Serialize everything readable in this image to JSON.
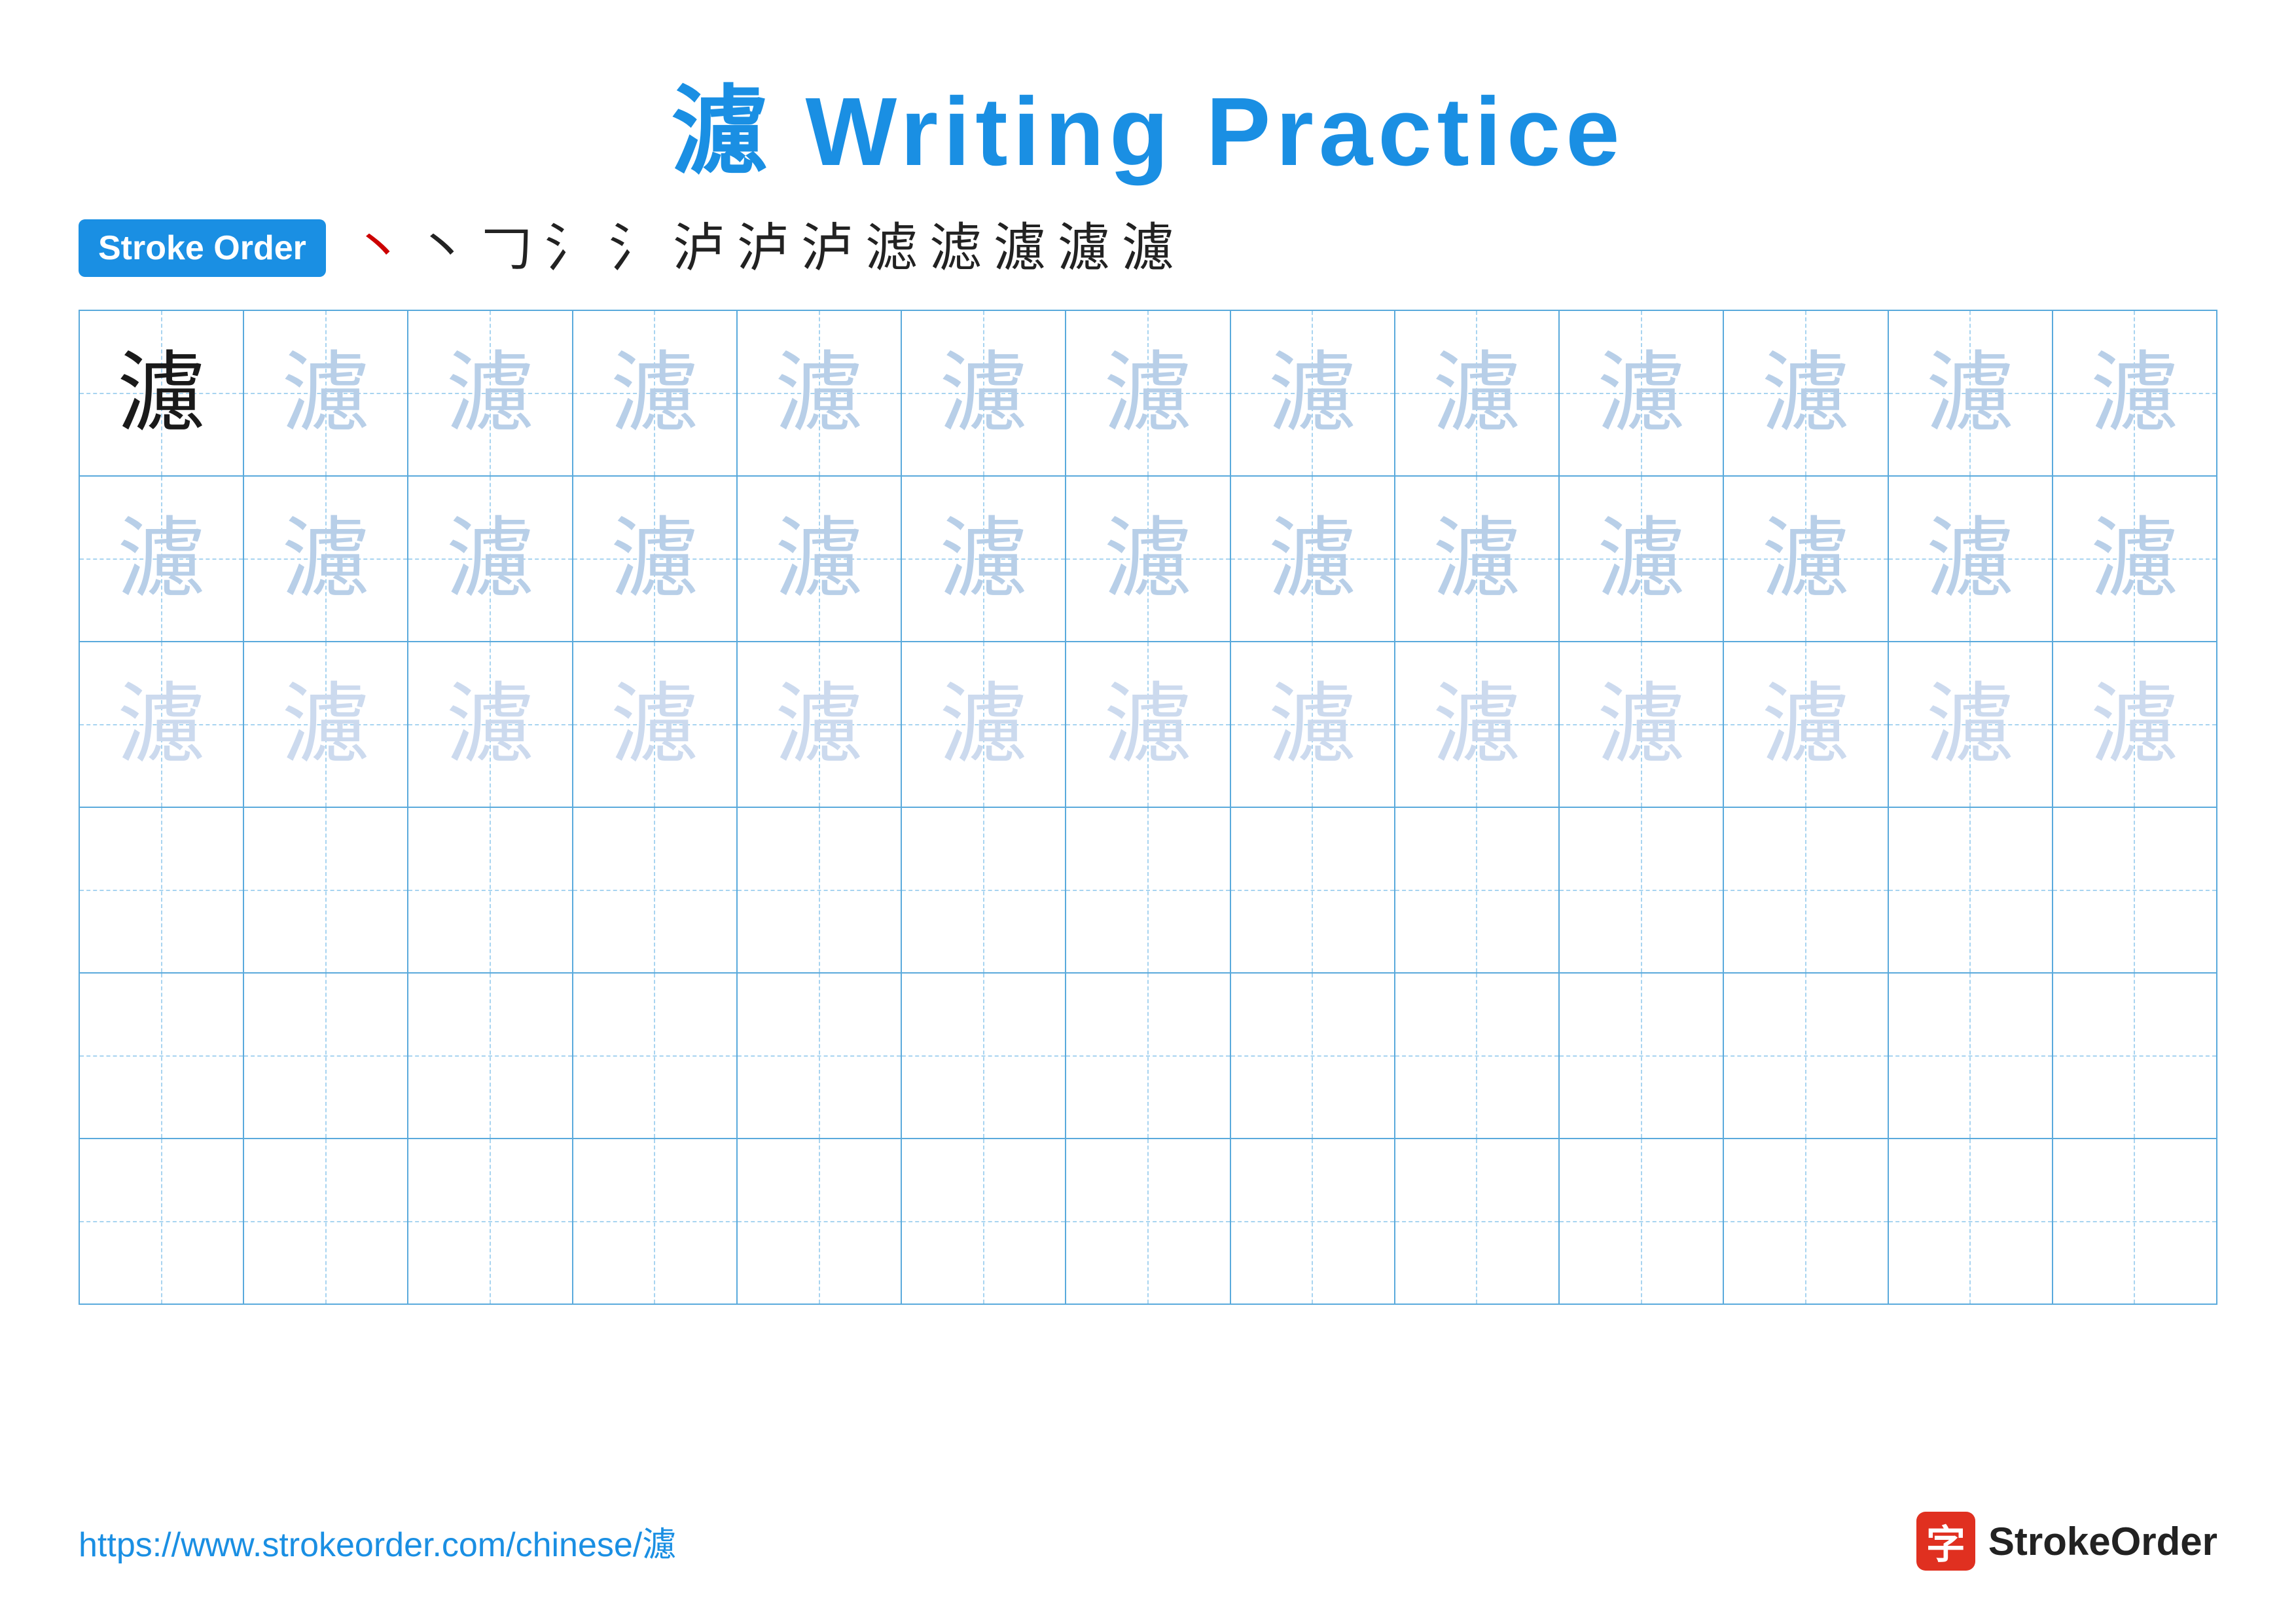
{
  "title": "濾 Writing Practice",
  "stroke_order_badge": "Stroke Order",
  "stroke_sequence": [
    "丶",
    "丶",
    "𠃌",
    "氵",
    "氵",
    "泸",
    "沪",
    "泸",
    "滤",
    "滤",
    "濾",
    "濾",
    "濾"
  ],
  "character": "濾",
  "rows": [
    {
      "cells": [
        {
          "type": "dark"
        },
        {
          "type": "light1"
        },
        {
          "type": "light1"
        },
        {
          "type": "light1"
        },
        {
          "type": "light1"
        },
        {
          "type": "light1"
        },
        {
          "type": "light1"
        },
        {
          "type": "light1"
        },
        {
          "type": "light1"
        },
        {
          "type": "light1"
        },
        {
          "type": "light1"
        },
        {
          "type": "light1"
        },
        {
          "type": "light1"
        }
      ]
    },
    {
      "cells": [
        {
          "type": "light1"
        },
        {
          "type": "light1"
        },
        {
          "type": "light1"
        },
        {
          "type": "light1"
        },
        {
          "type": "light1"
        },
        {
          "type": "light1"
        },
        {
          "type": "light1"
        },
        {
          "type": "light1"
        },
        {
          "type": "light1"
        },
        {
          "type": "light1"
        },
        {
          "type": "light1"
        },
        {
          "type": "light1"
        },
        {
          "type": "light1"
        }
      ]
    },
    {
      "cells": [
        {
          "type": "light2"
        },
        {
          "type": "light2"
        },
        {
          "type": "light2"
        },
        {
          "type": "light2"
        },
        {
          "type": "light2"
        },
        {
          "type": "light2"
        },
        {
          "type": "light2"
        },
        {
          "type": "light2"
        },
        {
          "type": "light2"
        },
        {
          "type": "light2"
        },
        {
          "type": "light2"
        },
        {
          "type": "light2"
        },
        {
          "type": "light2"
        }
      ]
    },
    {
      "cells": [
        {
          "type": "empty"
        },
        {
          "type": "empty"
        },
        {
          "type": "empty"
        },
        {
          "type": "empty"
        },
        {
          "type": "empty"
        },
        {
          "type": "empty"
        },
        {
          "type": "empty"
        },
        {
          "type": "empty"
        },
        {
          "type": "empty"
        },
        {
          "type": "empty"
        },
        {
          "type": "empty"
        },
        {
          "type": "empty"
        },
        {
          "type": "empty"
        }
      ]
    },
    {
      "cells": [
        {
          "type": "empty"
        },
        {
          "type": "empty"
        },
        {
          "type": "empty"
        },
        {
          "type": "empty"
        },
        {
          "type": "empty"
        },
        {
          "type": "empty"
        },
        {
          "type": "empty"
        },
        {
          "type": "empty"
        },
        {
          "type": "empty"
        },
        {
          "type": "empty"
        },
        {
          "type": "empty"
        },
        {
          "type": "empty"
        },
        {
          "type": "empty"
        }
      ]
    },
    {
      "cells": [
        {
          "type": "empty"
        },
        {
          "type": "empty"
        },
        {
          "type": "empty"
        },
        {
          "type": "empty"
        },
        {
          "type": "empty"
        },
        {
          "type": "empty"
        },
        {
          "type": "empty"
        },
        {
          "type": "empty"
        },
        {
          "type": "empty"
        },
        {
          "type": "empty"
        },
        {
          "type": "empty"
        },
        {
          "type": "empty"
        },
        {
          "type": "empty"
        }
      ]
    }
  ],
  "footer": {
    "url": "https://www.strokeorder.com/chinese/濾",
    "brand_text": "StrokeOrder",
    "brand_icon": "字"
  }
}
